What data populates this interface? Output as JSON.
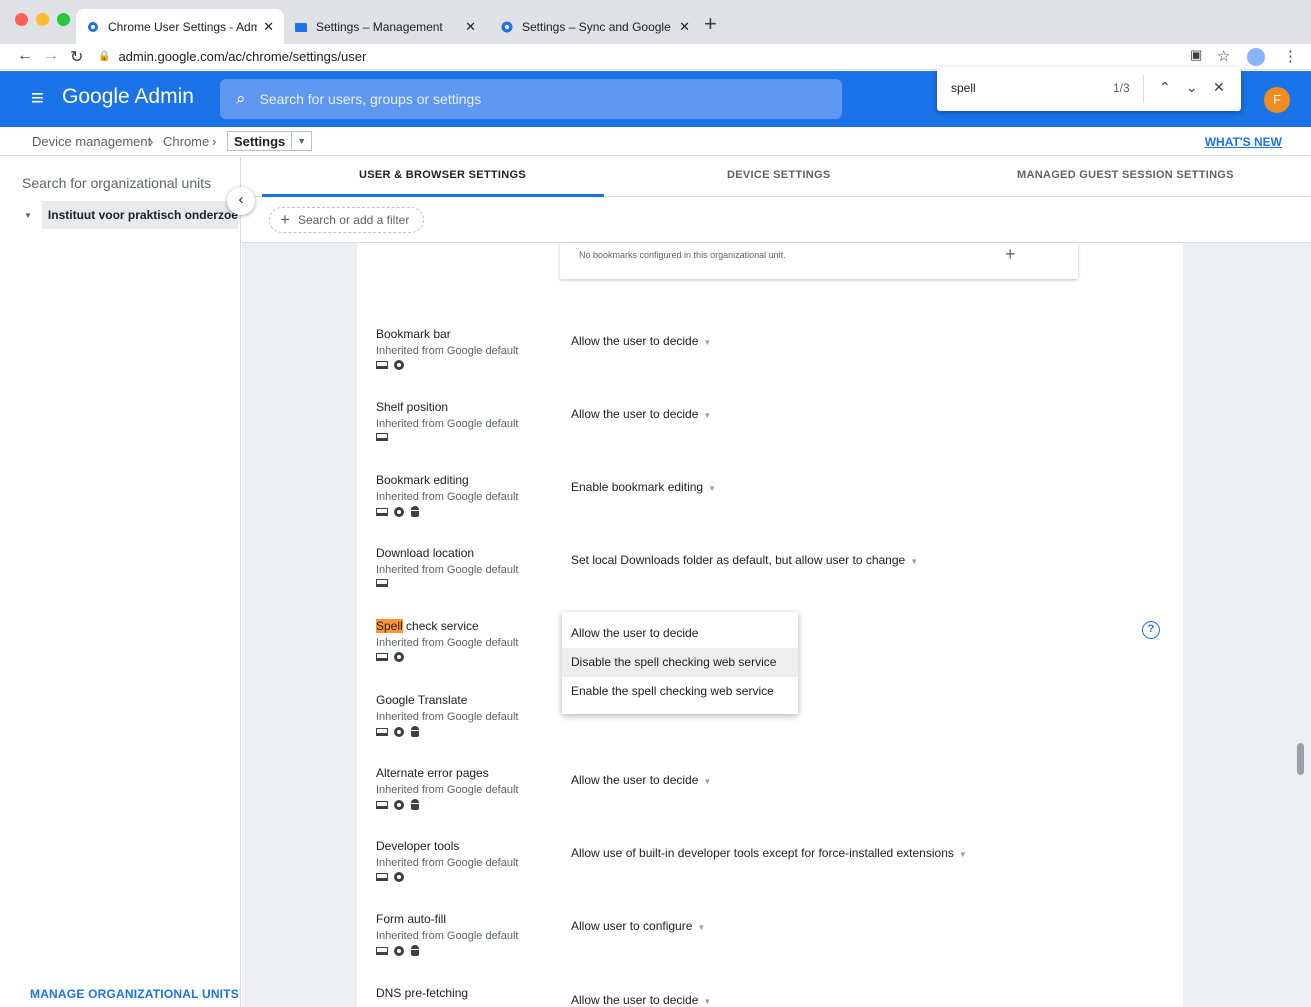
{
  "browser": {
    "tabs": [
      {
        "title": "Chrome User Settings - Admin",
        "active": true
      },
      {
        "title": "Settings – Management",
        "active": false
      },
      {
        "title": "Settings – Sync and Google services",
        "active": false
      }
    ],
    "url": "admin.google.com/ac/chrome/settings/user",
    "profile_initial": "F"
  },
  "header": {
    "brand": "Google Admin",
    "search_placeholder": "Search for users, groups or settings"
  },
  "find": {
    "query": "spell",
    "count": "1/3"
  },
  "breadcrumb": {
    "items": [
      "Device management",
      "Chrome"
    ],
    "selected": "Settings",
    "whats_new": "WHAT'S NEW"
  },
  "sidebar": {
    "search_placeholder": "Search for organizational units",
    "org_unit": "Instituut voor praktisch onderzoek",
    "manage_label": "MANAGE ORGANIZATIONAL UNITS"
  },
  "settings_tabs": [
    "USER & BROWSER SETTINGS",
    "DEVICE SETTINGS",
    "MANAGED GUEST SESSION SETTINGS"
  ],
  "filter": {
    "label": "Search or add a filter"
  },
  "bookmarks_empty": "No bookmarks configured in this organizational unit.",
  "settings": [
    {
      "name": "Bookmark bar",
      "inherited": "Inherited from Google default",
      "value": "Allow the user to decide",
      "icons": [
        "laptop-icon",
        "chrome-icon"
      ]
    },
    {
      "name": "Shelf position",
      "inherited": "Inherited from Google default",
      "value": "Allow the user to decide",
      "icons": [
        "laptop-icon"
      ]
    },
    {
      "name": "Bookmark editing",
      "inherited": "Inherited from Google default",
      "value": "Enable bookmark editing",
      "icons": [
        "laptop-icon",
        "chrome-icon",
        "android-icon"
      ]
    },
    {
      "name": "Download location",
      "inherited": "Inherited from Google default",
      "value": "Set local Downloads folder as default, but allow user to change",
      "icons": [
        "laptop-icon"
      ]
    },
    {
      "name_highlight": "Spell",
      "name_rest": " check service",
      "inherited": "Inherited from Google default",
      "icons": [
        "laptop-icon",
        "chrome-icon"
      ]
    },
    {
      "name": "Google Translate",
      "inherited": "Inherited from Google default",
      "icons": [
        "laptop-icon",
        "chrome-icon",
        "android-icon"
      ]
    },
    {
      "name": "Alternate error pages",
      "inherited": "Inherited from Google default",
      "value": "Allow the user to decide",
      "icons": [
        "laptop-icon",
        "chrome-icon",
        "android-icon"
      ]
    },
    {
      "name": "Developer tools",
      "inherited": "Inherited from Google default",
      "value": "Allow use of built-in developer tools except for force-installed extensions",
      "icons": [
        "laptop-icon",
        "chrome-icon"
      ]
    },
    {
      "name": "Form auto-fill",
      "inherited": "Inherited from Google default",
      "value": "Allow user to configure",
      "icons": [
        "laptop-icon",
        "chrome-icon",
        "android-icon"
      ]
    },
    {
      "name": "DNS pre-fetching",
      "value": "Allow the user to decide"
    }
  ],
  "dropdown": {
    "options": [
      "Allow the user to decide",
      "Disable the spell checking web service",
      "Enable the spell checking web service"
    ],
    "hovered_index": 1
  },
  "colors": {
    "brand_blue": "#1a73e8",
    "find_highlight": "#ff9632",
    "avatar": "#f28b20"
  }
}
